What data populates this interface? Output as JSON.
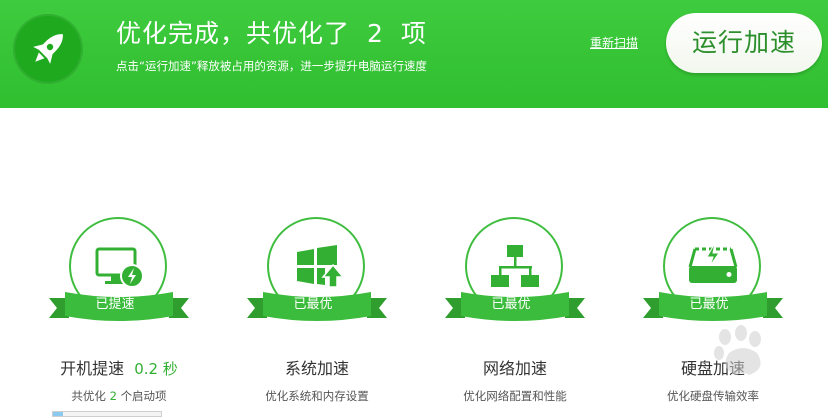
{
  "header": {
    "title_prefix": "优化完成，共优化了",
    "optimized_count": "2",
    "title_suffix": "项",
    "subtitle": "点击“运行加速”释放被占用的资源，进一步提升电脑运行速度",
    "rescan_label": "重新扫描",
    "run_button_label": "运行加速",
    "logo_icon": "rocket-icon",
    "colors": {
      "header_bg": "#3cc83c",
      "accent": "#33b033"
    }
  },
  "cards": [
    {
      "icon": "monitor-bolt-icon",
      "status": "已提速",
      "name": "开机提速",
      "time": "0.2 秒",
      "desc_prefix": "共优化",
      "desc_count": "2",
      "desc_suffix": "个启动项",
      "progress_fraction": 0.09
    },
    {
      "icon": "windows-upgrade-icon",
      "status": "已最优",
      "name": "系统加速",
      "desc": "优化系统和内存设置"
    },
    {
      "icon": "network-tree-icon",
      "status": "已最优",
      "name": "网络加速",
      "desc": "优化网络配置和性能"
    },
    {
      "icon": "hard-disk-bolt-icon",
      "status": "已最优",
      "name": "硬盘加速",
      "desc": "优化硬盘传输效率"
    }
  ]
}
